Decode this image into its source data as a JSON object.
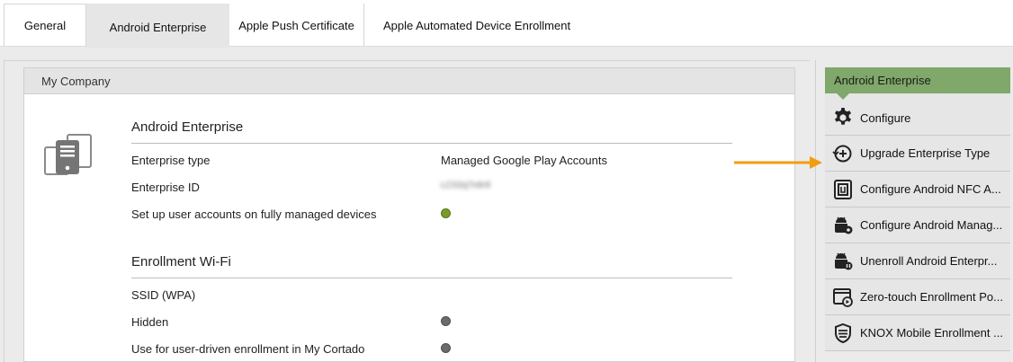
{
  "tabs": [
    "General",
    "Android Enterprise",
    "Apple Push Certificate",
    "Apple Automated Device Enrollment"
  ],
  "card": {
    "header": "My Company",
    "icon": "device-stack-icon",
    "enterprise_section": {
      "title": "Android Enterprise",
      "rows": [
        {
          "label": "Enterprise type",
          "value": "Managed Google Play Accounts"
        },
        {
          "label": "Enterprise ID",
          "value": "LC02q7n6r9"
        },
        {
          "label": "Set up user accounts on fully managed devices",
          "state": "on"
        }
      ]
    },
    "wifi_section": {
      "title": "Enrollment Wi-Fi",
      "rows": [
        {
          "label": "SSID (WPA)"
        },
        {
          "label": "Hidden",
          "state": "off"
        },
        {
          "label": "Use for user-driven enrollment in My Cortado",
          "state": "off"
        }
      ]
    }
  },
  "panel": {
    "header": "Android Enterprise",
    "actions": [
      {
        "label": "Configure",
        "icon": "gear-icon"
      },
      {
        "label": "Upgrade Enterprise Type",
        "icon": "upgrade-icon"
      },
      {
        "label": "Configure Android NFC A...",
        "icon": "nfc-icon"
      },
      {
        "label": "Configure Android Manag...",
        "icon": "android-gear-icon"
      },
      {
        "label": "Unenroll Android Enterpr...",
        "icon": "android-unenroll-icon"
      },
      {
        "label": "Zero-touch Enrollment Po...",
        "icon": "zero-touch-icon"
      },
      {
        "label": "KNOX Mobile Enrollment ...",
        "icon": "knox-shield-icon"
      }
    ]
  },
  "colors": {
    "accent_green": "#7fa86a",
    "annotation_arrow": "#f39c12",
    "status_on": "#7a9a2a",
    "status_off": "#6b6b6b"
  }
}
